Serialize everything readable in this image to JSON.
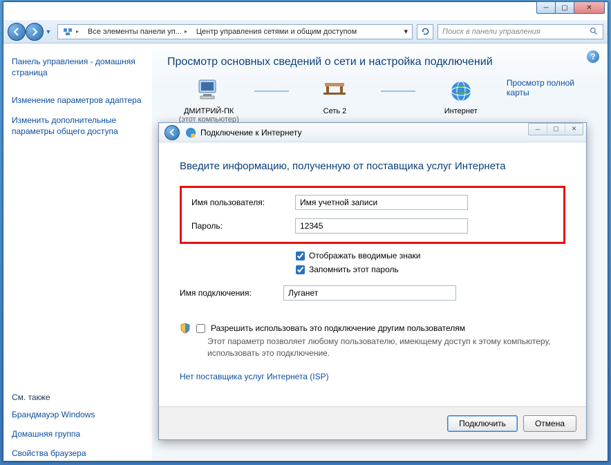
{
  "breadcrumb": {
    "part1": "Все элементы панели уп...",
    "part2": "Центр управления сетями и общим доступом"
  },
  "search_placeholder": "Поиск в панели управления",
  "sidebar": {
    "home": "Панель управления - домашняя страница",
    "adapter": "Изменение параметров адаптера",
    "sharing": "Изменить дополнительные параметры общего доступа",
    "see_also": "См. также",
    "firewall": "Брандмауэр Windows",
    "homegroup": "Домашняя группа",
    "browser": "Свойства браузера"
  },
  "main": {
    "title": "Просмотр основных сведений о сети и настройка подключений",
    "map_link": "Просмотр полной карты",
    "pc_name": "ДМИТРИЙ-ПК",
    "pc_sub": "(этот компьютер)",
    "net_name": "Сеть 2",
    "internet": "Интернет"
  },
  "dialog": {
    "title": "Подключение к Интернету",
    "heading": "Введите информацию, полученную от поставщика услуг Интернета",
    "user_label": "Имя пользователя:",
    "user_value": "Имя учетной записи",
    "pass_label": "Пароль:",
    "pass_value": "12345",
    "show_chars": "Отображать вводимые знаки",
    "remember": "Запомнить этот пароль",
    "conn_label": "Имя подключения:",
    "conn_value": "Луганет",
    "allow_others": "Разрешить использовать это подключение другим пользователям",
    "allow_desc": "Этот параметр позволяет любому пользователю, имеющему доступ к этому компьютеру, использовать это подключение.",
    "isp_link": "Нет поставщика услуг Интернета (ISP)",
    "connect": "Подключить",
    "cancel": "Отмена"
  }
}
